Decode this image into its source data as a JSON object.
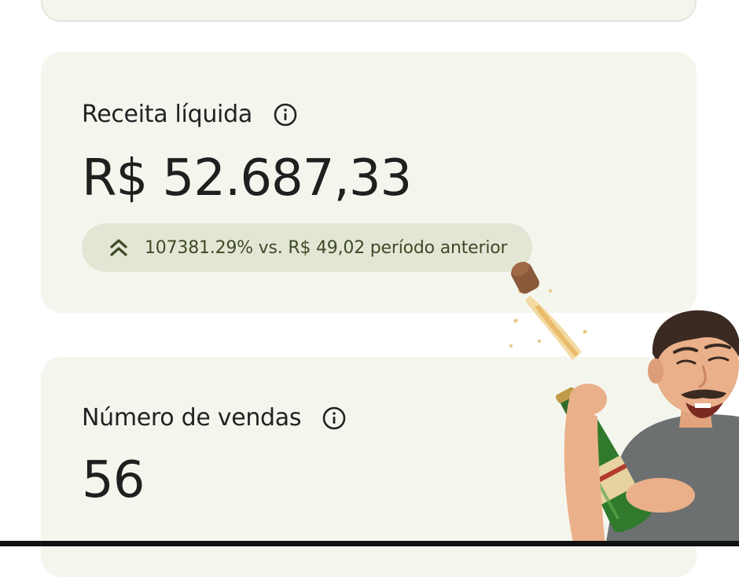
{
  "revenue": {
    "label": "Receita líquida",
    "value": "R$ 52.687,33",
    "delta_text": "107381.29% vs. R$ 49,02 período anterior"
  },
  "sales": {
    "label": "Número de vendas",
    "value": "56"
  },
  "icons": {
    "info": "info-icon",
    "trend": "double-chevron-up-icon",
    "sticker": "champagne-celebration-sticker"
  },
  "colors": {
    "card_background": "#f4f6ee",
    "pill_background": "#e3e6d4",
    "accent_green": "#3e4a26"
  }
}
